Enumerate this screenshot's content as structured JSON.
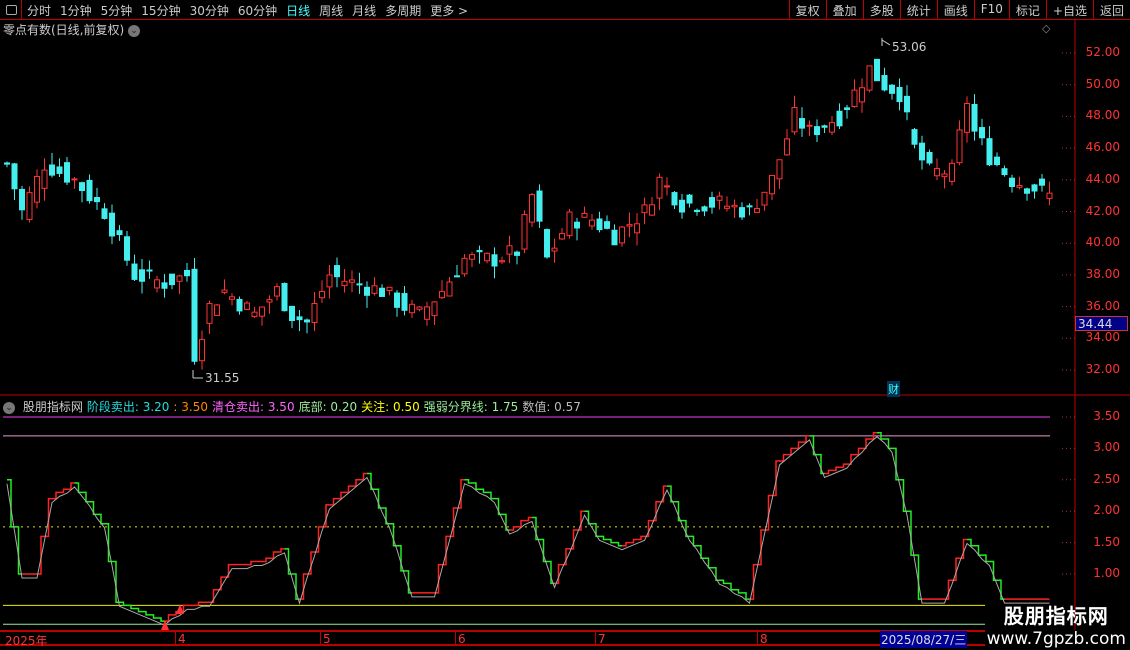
{
  "toolbar": {
    "periods": [
      "分时",
      "1分钟",
      "5分钟",
      "15分钟",
      "30分钟",
      "60分钟",
      "日线",
      "周线",
      "月线",
      "多周期",
      "更多 >"
    ],
    "active": "日线",
    "buttons": [
      "复权",
      "叠加",
      "多股",
      "统计",
      "画线",
      "F10",
      "标记",
      "+自选",
      "返回"
    ]
  },
  "main": {
    "title": "零点有数(日线,前复权)",
    "high_label": "53.06",
    "low_label": "31.55",
    "current_price": "34.44",
    "finance_badge": "财",
    "y_ticks": [
      "52.00",
      "50.00",
      "48.00",
      "46.00",
      "44.00",
      "42.00",
      "40.00",
      "38.00",
      "36.00",
      "34.00",
      "32.00"
    ]
  },
  "indicator": {
    "name": "股朋指标网",
    "items": [
      {
        "label": "阶段卖出: 3.20",
        "color": "#2dd"
      },
      {
        "label": ": 3.50",
        "color": "#f80"
      },
      {
        "label": "清仓卖出: 3.50",
        "color": "#f6f"
      },
      {
        "label": "底部: 0.20",
        "color": "#9e9"
      },
      {
        "label": "关注: 0.50",
        "color": "#ff0"
      },
      {
        "label": "强弱分界线: 1.75",
        "color": "#9e9"
      },
      {
        "label": "数值: 0.57",
        "color": "#bbb"
      }
    ],
    "y_ticks": [
      "3.50",
      "3.00",
      "2.50",
      "2.00",
      "1.50",
      "1.00"
    ]
  },
  "time_axis": {
    "labels": [
      "2025年",
      "4",
      "5",
      "6",
      "7",
      "8"
    ],
    "current_date": "2025/08/27/三"
  },
  "watermark": {
    "line1": "股朋指标网",
    "line2": "www.7gpzb.com"
  },
  "chart_data": {
    "type": "candlestick",
    "price_range": [
      30.5,
      54
    ],
    "close_keypoints": [
      [
        0,
        45
      ],
      [
        2,
        42
      ],
      [
        5,
        45
      ],
      [
        9,
        44
      ],
      [
        13,
        42
      ],
      [
        17,
        38
      ],
      [
        21,
        37.5
      ],
      [
        24,
        38
      ],
      [
        25,
        33
      ],
      [
        27,
        36
      ],
      [
        29,
        37
      ],
      [
        33,
        35.5
      ],
      [
        36,
        37
      ],
      [
        38,
        35.5
      ],
      [
        40,
        35
      ],
      [
        43,
        38
      ],
      [
        46,
        37.5
      ],
      [
        50,
        37
      ],
      [
        53,
        36
      ],
      [
        55,
        35.5
      ],
      [
        58,
        37
      ],
      [
        61,
        39
      ],
      [
        65,
        39
      ],
      [
        68,
        39.5
      ],
      [
        70,
        43
      ],
      [
        72,
        39
      ],
      [
        75,
        41.5
      ],
      [
        78,
        41.5
      ],
      [
        81,
        40.5
      ],
      [
        85,
        42
      ],
      [
        87,
        44
      ],
      [
        90,
        42.5
      ],
      [
        95,
        42.5
      ],
      [
        99,
        42
      ],
      [
        102,
        44
      ],
      [
        105,
        48
      ],
      [
        107,
        47
      ],
      [
        111,
        48
      ],
      [
        115,
        51
      ],
      [
        117,
        50
      ],
      [
        119,
        49.5
      ],
      [
        121,
        46
      ],
      [
        123,
        44.5
      ],
      [
        126,
        44.5
      ],
      [
        128,
        49
      ],
      [
        129,
        47
      ],
      [
        131,
        45.5
      ],
      [
        134,
        44
      ],
      [
        137,
        43.5
      ],
      [
        139,
        43
      ]
    ],
    "count": 140,
    "indicator_range": [
      0,
      3.75
    ],
    "indicator_keypoints": [
      [
        0,
        2.5
      ],
      [
        2,
        1.0
      ],
      [
        4,
        1.0
      ],
      [
        6,
        2.2
      ],
      [
        9,
        2.45
      ],
      [
        13,
        1.8
      ],
      [
        15,
        0.55
      ],
      [
        21,
        0.25
      ],
      [
        24,
        0.5
      ],
      [
        27,
        0.55
      ],
      [
        30,
        1.15
      ],
      [
        34,
        1.2
      ],
      [
        37,
        1.4
      ],
      [
        39,
        0.6
      ],
      [
        43,
        2.1
      ],
      [
        48,
        2.6
      ],
      [
        51,
        1.8
      ],
      [
        54,
        0.7
      ],
      [
        57,
        0.7
      ],
      [
        61,
        2.5
      ],
      [
        65,
        2.2
      ],
      [
        67,
        1.7
      ],
      [
        70,
        1.9
      ],
      [
        73,
        0.85
      ],
      [
        77,
        2.0
      ],
      [
        79,
        1.6
      ],
      [
        82,
        1.45
      ],
      [
        85,
        1.6
      ],
      [
        88,
        2.4
      ],
      [
        91,
        1.6
      ],
      [
        95,
        0.9
      ],
      [
        99,
        0.6
      ],
      [
        103,
        2.8
      ],
      [
        107,
        3.2
      ],
      [
        109,
        2.6
      ],
      [
        112,
        2.75
      ],
      [
        116,
        3.25
      ],
      [
        118,
        3.0
      ],
      [
        120,
        2.0
      ],
      [
        122,
        0.6
      ],
      [
        125,
        0.6
      ],
      [
        128,
        1.55
      ],
      [
        131,
        1.2
      ],
      [
        133,
        0.6
      ],
      [
        139,
        0.6
      ]
    ],
    "levels": {
      "stage_sell": 3.2,
      "clear_sell": 3.5,
      "bottom": 0.2,
      "watch": 0.5,
      "divider": 1.75
    }
  }
}
